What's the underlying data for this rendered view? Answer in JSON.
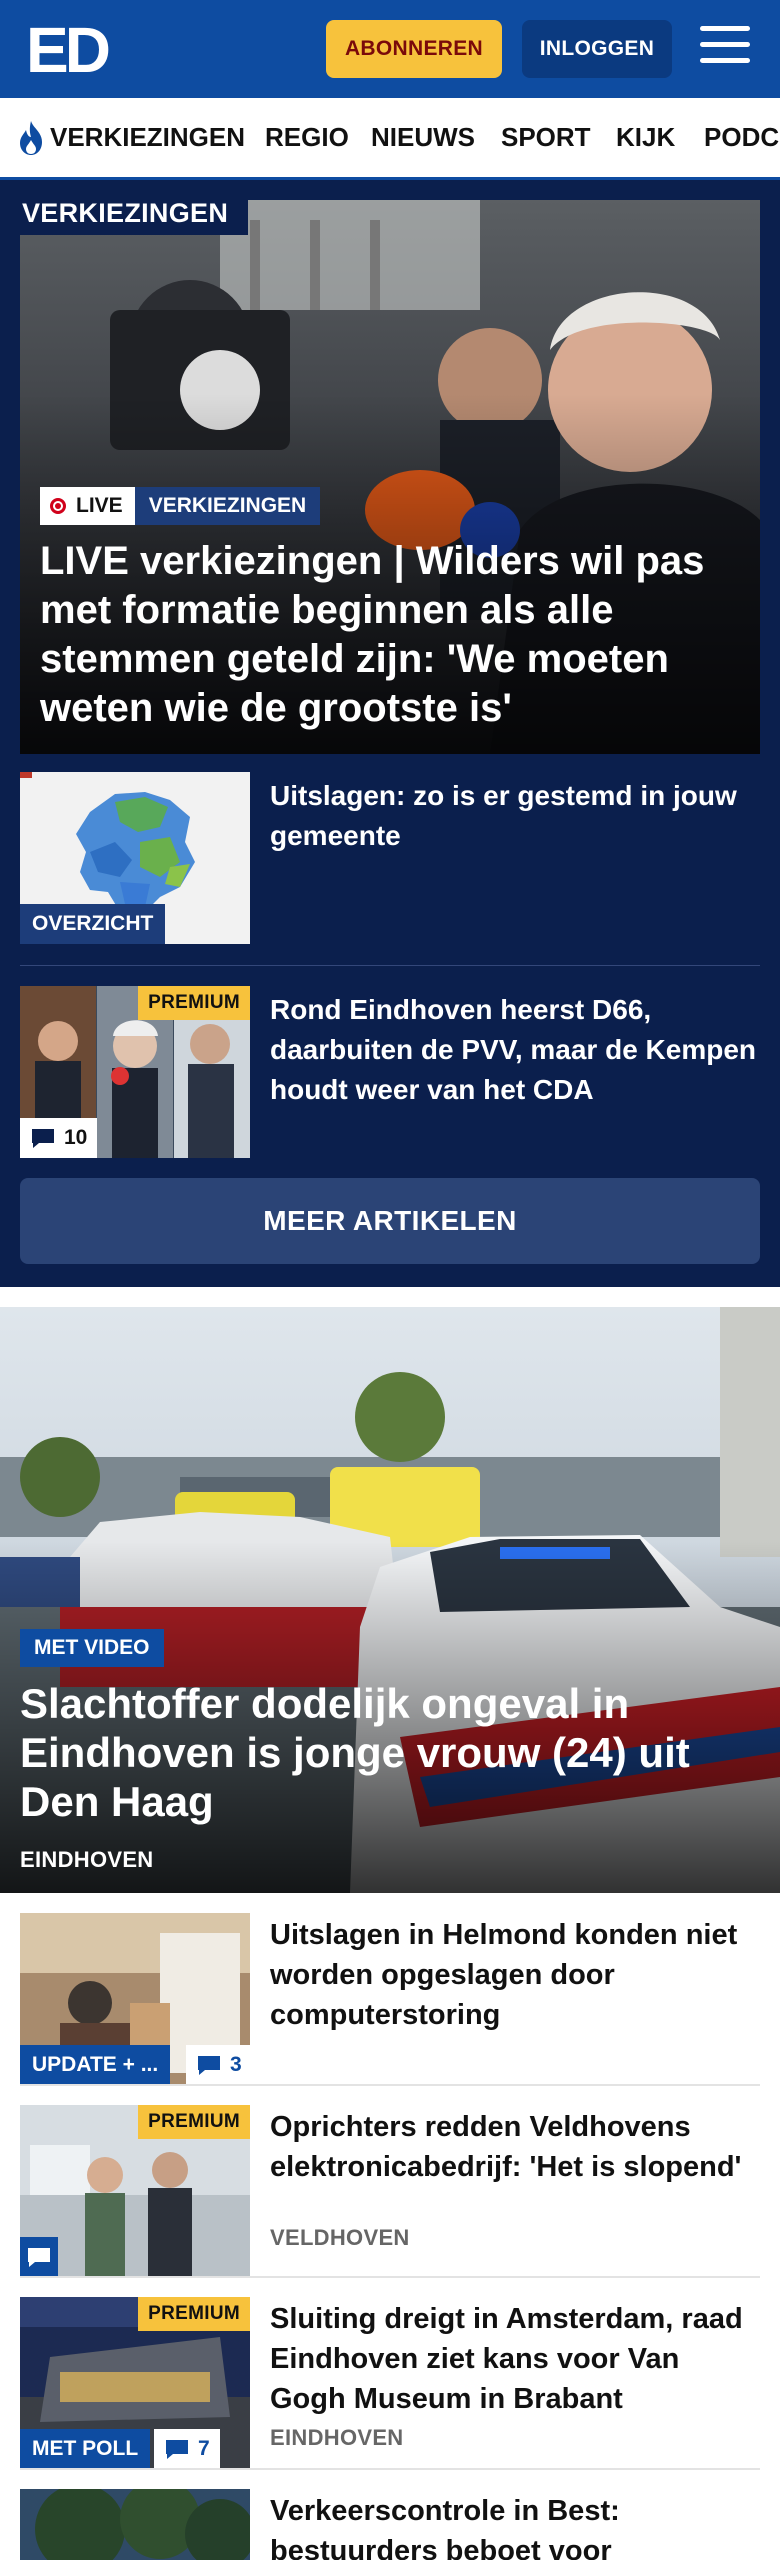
{
  "header": {
    "logo_text": "ED",
    "subscribe_label": "ABONNEREN",
    "login_label": "INLOGGEN"
  },
  "nav": {
    "items": [
      "VERKIEZINGEN",
      "REGIO",
      "NIEUWS",
      "SPORT",
      "KIJK",
      "PODC"
    ]
  },
  "elections": {
    "section_label": "VERKIEZINGEN",
    "hero": {
      "live_label": "LIVE",
      "category": "VERKIEZINGEN",
      "title": "LIVE verkiezingen | Wilders wil pas met formatie beginnen als alle stemmen geteld zijn: 'We moeten weten wie de grootste is'"
    },
    "items": [
      {
        "title": "Uitslagen: zo is er gestemd in jouw gemeente",
        "tag": "OVERZICHT"
      },
      {
        "title": "Rond Eindhoven heerst D66, daarbuiten de PVV, maar de Kempen houdt weer van het CDA",
        "premium": "PREMIUM",
        "comments": "10"
      }
    ],
    "more_label": "MEER ARTIKELEN"
  },
  "main_hero": {
    "tag": "MET VIDEO",
    "title": "Slachtoffer dodelijk ongeval in Eindhoven is jonge vrouw (24) uit Den Haag",
    "location": "EINDHOVEN"
  },
  "articles": [
    {
      "title": "Uitslagen in Helmond konden niet worden opgeslagen door computerstoring",
      "tag": "UPDATE + ...",
      "comments": "3"
    },
    {
      "title": "Oprichters redden Veldhovens elektronicabedrijf: 'Het is slopend'",
      "premium": "PREMIUM",
      "location": "VELDHOVEN"
    },
    {
      "title": "Sluiting dreigt in Amsterdam, raad Eindhoven ziet kans voor Van Gogh Museum in Brabant",
      "premium": "PREMIUM",
      "tag": "MET POLL",
      "comments": "7",
      "location": "EINDHOVEN"
    },
    {
      "title": "Verkeerscontrole in Best: bestuurders beboet voor"
    }
  ],
  "colors": {
    "brand_blue": "#0e4ca1",
    "dark_navy": "#0b1f4d",
    "accent_yellow": "#f7c23c"
  }
}
